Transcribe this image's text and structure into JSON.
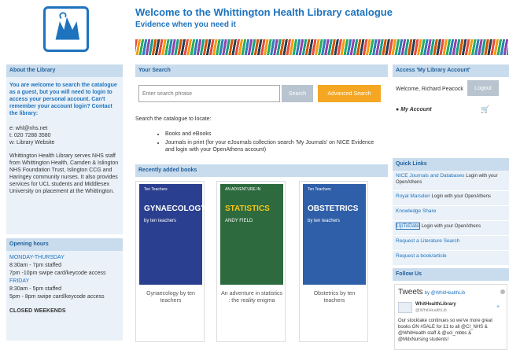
{
  "header": {
    "title": "Welcome to the Whittington Health Library catalogue",
    "subtitle": "Evidence when you need it"
  },
  "about": {
    "heading": "About the Library",
    "intro": "You are welcome to search the catalogue as a guest, but you will need to login to access your personal account. Can't remember your account login? Contact the library:",
    "email": "e: whl@nhs.net",
    "phone": "t: 020 7288 3580",
    "web": "w: Library Website",
    "body": "Whittington Health Library serves NHS staff from Whittington Health, Camden & Islington NHS Foundation Trust, Islington CCG and Haringey community nurses. It also provides services for UCL students and Middlesex University on placement at the Whittington."
  },
  "hours": {
    "heading": "Opening hours",
    "mt_label": "MONDAY-THURSDAY",
    "mt_staffed": "8:30am - 7pm staffed",
    "mt_swipe": "7pm -10pm swipe card/keycode access",
    "fri_label": "FRIDAY",
    "fri_staffed": "8:30am - 5pm staffed",
    "fri_swipe": "5pm - 8pm swipe card/keycode access",
    "closed": "CLOSED WEEKENDS"
  },
  "search": {
    "heading": "Your Search",
    "placeholder": "Enter search phrase",
    "search_label": "Search",
    "advanced_label": "Advanced Search",
    "locate_text": "Search the catalogue to locate:",
    "items": [
      "Books and eBooks",
      "Journals in print (for your eJournals collection search 'My Journals' on NICE Evidence and login with your OpenAthens account)"
    ]
  },
  "recent": {
    "heading": "Recently added books",
    "books": [
      {
        "cover_title": "GYNAECOLOGY",
        "cover_sub": "by ten teachers",
        "cover_label": "Ten Teachers",
        "caption": "Gynaecology by ten teachers",
        "color": "#2a3f8f"
      },
      {
        "cover_title": "STATISTICS",
        "cover_sub": "ANDY FIELD",
        "cover_label": "AN ADVENTURE IN",
        "caption": "An adventure in statistics : the reality enigma",
        "color": "#2d6a3e"
      },
      {
        "cover_title": "OBSTETRICS",
        "cover_sub": "by ten teachers",
        "cover_label": "Ten Teachers",
        "caption": "Obstetrics by ten teachers",
        "color": "#2f5fa8"
      }
    ]
  },
  "account": {
    "heading": "Access 'My Library Account'",
    "welcome": "Welcome, Richard Peacock",
    "logout_label": "Logout",
    "my_account": "My Account"
  },
  "quick_links": {
    "heading": "Quick Links",
    "items": [
      {
        "label": "NICE Journals and Databases",
        "note": "Login with your OpenAthens"
      },
      {
        "label": "Royal Marsden",
        "note": "Login with your OpenAthens"
      },
      {
        "label": "Knowledge Share",
        "note": ""
      },
      {
        "label": "UpToDate",
        "note": "Login with your OpenAthens"
      },
      {
        "label": "Request a Literature Search",
        "note": ""
      },
      {
        "label": "Request a book/article",
        "note": ""
      }
    ]
  },
  "follow": {
    "heading": "Follow Us",
    "tweets_title": "Tweets",
    "tweets_by": "by @WhitHealthLib",
    "user": "WhitHealthLibrary",
    "handle": "@WhitHealthLib",
    "text": "Our stocktake continues so we've more great books ON #SALE for £1 to all @CI_NHS & @WhitHealth staff & @ucl_mbbs & @MdxNursing students!"
  }
}
